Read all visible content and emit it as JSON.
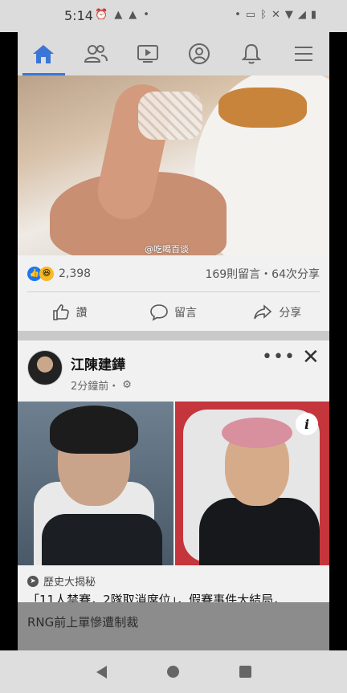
{
  "status_bar": {
    "time": "5:14"
  },
  "nav": {
    "items": [
      {
        "name": "home-icon",
        "active": true
      },
      {
        "name": "friends-icon",
        "active": false
      },
      {
        "name": "watch-icon",
        "active": false
      },
      {
        "name": "profile-icon",
        "active": false
      },
      {
        "name": "notifications-icon",
        "active": false
      },
      {
        "name": "menu-icon",
        "active": false
      }
    ],
    "accent": "#3b76d6"
  },
  "post1": {
    "watermark": "@吃喝百谈",
    "reaction_count": "2,398",
    "stats": "169則留言・64次分享",
    "actions": {
      "like": "讚",
      "comment": "留言",
      "share": "分享"
    }
  },
  "post2": {
    "author": "江陳建鏵",
    "time": "2分鐘前・",
    "more": "•••",
    "close": "✕",
    "source": "歷史大揭秘",
    "headline_line1": "「11人禁賽，2隊取消席位」，假賽事件大結局，",
    "headline_line2": "RNG前上單慘遭制裁"
  }
}
